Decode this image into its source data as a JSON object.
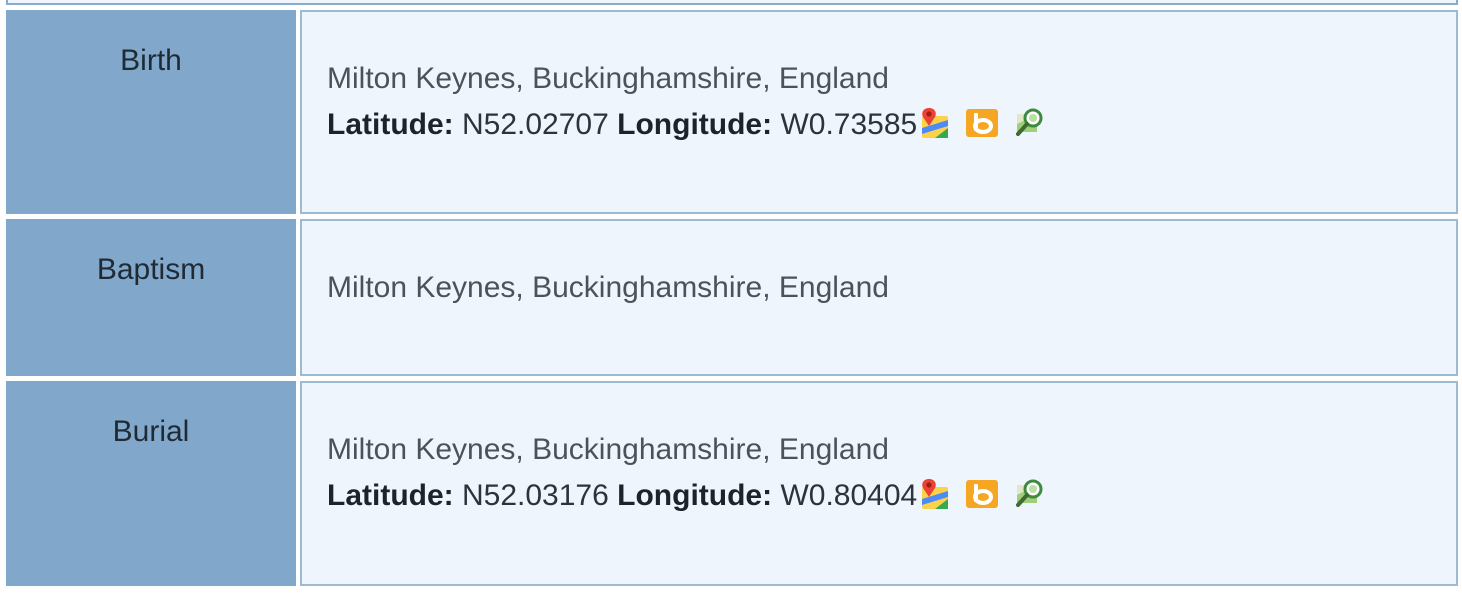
{
  "events": [
    {
      "label": "Birth",
      "place": "Milton Keynes, Buckinghamshire, England",
      "latitude_label": "Latitude:",
      "latitude": "N52.02707",
      "longitude_label": "Longitude:",
      "longitude": "W0.73585",
      "icons": [
        "google-maps-icon",
        "bing-maps-icon",
        "map-search-icon"
      ]
    },
    {
      "label": "Baptism",
      "place": "Milton Keynes, Buckinghamshire, England"
    },
    {
      "label": "Burial",
      "place": "Milton Keynes, Buckinghamshire, England",
      "latitude_label": "Latitude:",
      "latitude": "N52.03176",
      "longitude_label": "Longitude:",
      "longitude": "W0.80404",
      "icons": [
        "google-maps-icon",
        "bing-maps-icon",
        "map-search-icon"
      ]
    }
  ],
  "colors": {
    "label_bg": "#81a8cb",
    "value_bg": "#eef5fd",
    "border": "#9ebad3",
    "bing_orange": "#f5a623"
  }
}
